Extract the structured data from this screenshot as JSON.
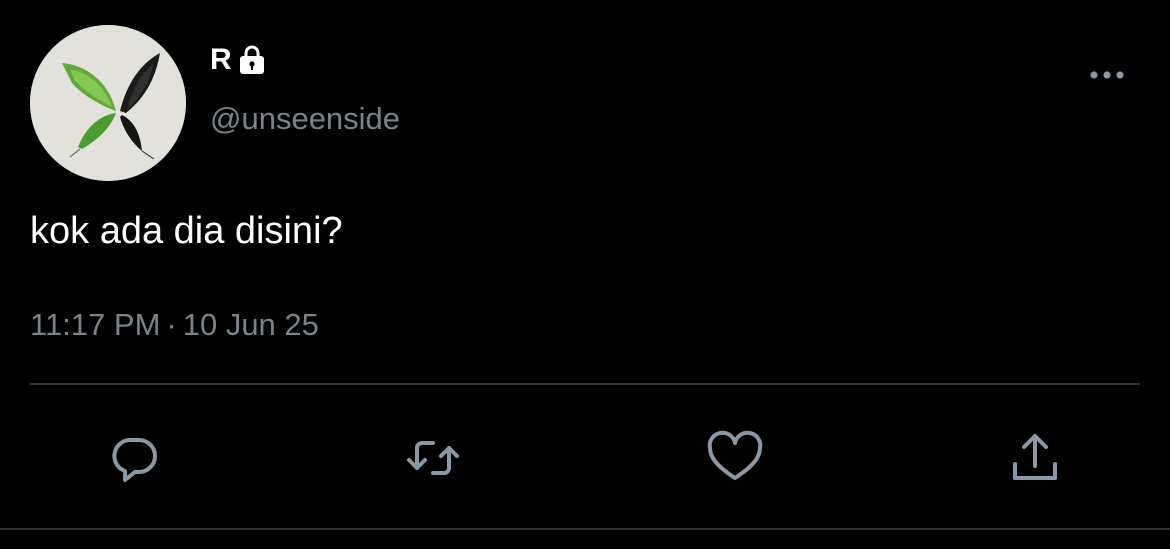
{
  "user": {
    "display_name": "R",
    "handle": "@unseenside",
    "avatar_icon": "butterfly-avatar",
    "protected_icon": "lock-icon"
  },
  "tweet": {
    "text": "kok ada dia disini?",
    "time": "11:17 PM",
    "separator": "·",
    "date": "10 Jun 25"
  },
  "actions": {
    "reply_icon": "reply-icon",
    "retweet_icon": "retweet-icon",
    "like_icon": "heart-icon",
    "share_icon": "share-icon",
    "more_icon": "more-icon"
  },
  "colors": {
    "background": "#000000",
    "text": "#ffffff",
    "secondary_text": "#7c8289",
    "divider": "#2f3336",
    "icon": "#8b98a5"
  }
}
